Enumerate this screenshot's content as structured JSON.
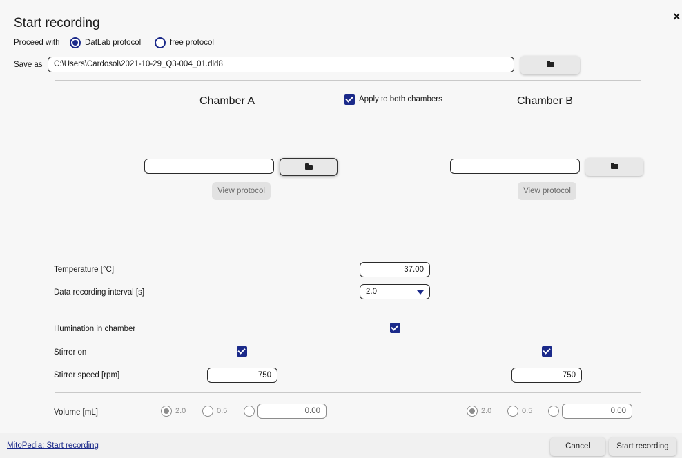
{
  "dialog": {
    "title": "Start recording",
    "close_glyph": "×"
  },
  "proceed": {
    "label": "Proceed with",
    "options": [
      {
        "label": "DatLab protocol",
        "selected": true
      },
      {
        "label": "free protocol",
        "selected": false
      }
    ]
  },
  "save_as": {
    "label": "Save as",
    "value": "C:\\Users\\Cardosol\\2021-10-29_Q3-004_01.dld8",
    "browse_icon": "folder-icon"
  },
  "chambers": {
    "a_title": "Chamber A",
    "b_title": "Chamber B",
    "apply_both_label": "Apply to both chambers",
    "apply_both_checked": true,
    "a_protocol_value": "",
    "b_protocol_value": "",
    "view_protocol_label": "View protocol"
  },
  "settings": {
    "temperature_label": "Temperature [°C]",
    "temperature_value": "37.00",
    "interval_label": "Data recording interval [s]",
    "interval_value": "2.0",
    "illumination_label": "Illumination in chamber",
    "illumination_checked": true,
    "stirrer_on_label": "Stirrer on",
    "stirrer_a_checked": true,
    "stirrer_b_checked": true,
    "stirrer_speed_label": "Stirrer speed [rpm]",
    "stirrer_speed_a": "750",
    "stirrer_speed_b": "750",
    "volume_label": "Volume [mL]",
    "volume_options": [
      "2.0",
      "0.5"
    ],
    "volume_a_custom": "0.00",
    "volume_b_custom": "0.00",
    "volume_selected": "2.0"
  },
  "footer": {
    "help_link": "MitoPedia: Start recording",
    "cancel_label": "Cancel",
    "start_label": "Start recording"
  },
  "colors": {
    "accent": "#1b2a8a",
    "background": "#f7f7f7",
    "disabled": "#8c8c8c"
  }
}
